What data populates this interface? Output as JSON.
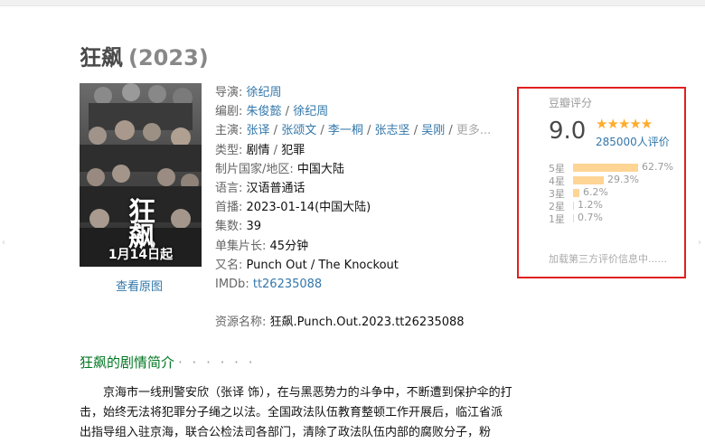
{
  "title": "狂飙",
  "year": "(2023)",
  "poster": {
    "title": "狂飙",
    "date": "1月14日起",
    "view_link": "查看原图"
  },
  "info": {
    "director_label": "导演:",
    "director": "徐纪周",
    "writer_label": "编剧:",
    "writers": [
      "朱俊懿",
      "徐纪周"
    ],
    "cast_label": "主演:",
    "cast": [
      "张译",
      "张颂文",
      "李一桐",
      "张志坚",
      "吴刚"
    ],
    "cast_more": "更多...",
    "genre_label": "类型:",
    "genres": [
      "剧情",
      "犯罪"
    ],
    "country_label": "制片国家/地区:",
    "country": "中国大陆",
    "language_label": "语言:",
    "language": "汉语普通话",
    "premiere_label": "首播:",
    "premiere": "2023-01-14(中国大陆)",
    "episodes_label": "集数:",
    "episodes": "39",
    "runtime_label": "单集片长:",
    "runtime": "45分钟",
    "aka_label": "又名:",
    "aka": "Punch Out / The Knockout",
    "imdb_label": "IMDb:",
    "imdb": "tt26235088"
  },
  "source": {
    "label": "资源名称:",
    "value": "狂飙.Punch.Out.2023.tt26235088"
  },
  "synopsis": {
    "heading": "狂飙的剧情简介",
    "dots": "· · · · · ·",
    "text": "京海市一线刑警安欣（张译 饰），在与黑恶势力的斗争中，不断遭到保护伞的打击，始终无法将犯罪分子绳之以法。全国政法队伍教育整顿工作开展后，临江省派出指导组入驻京海，联合公检法司各部门，清除了政法队伍内部的腐败分子，粉"
  },
  "rating": {
    "title": "豆瓣评分",
    "score": "9.0",
    "stars": "★★★★★",
    "count": "285000人评价",
    "distribution": [
      {
        "label": "5星",
        "pct": "62.7%",
        "value": 62.7
      },
      {
        "label": "4星",
        "pct": "29.3%",
        "value": 29.3
      },
      {
        "label": "3星",
        "pct": "6.2%",
        "value": 6.2
      },
      {
        "label": "2星",
        "pct": "1.2%",
        "value": 1.2
      },
      {
        "label": "1星",
        "pct": "0.7%",
        "value": 0.7
      }
    ],
    "loading": "加载第三方评价信息中......"
  },
  "colors": {
    "link": "#3377aa",
    "green_heading": "#007722",
    "star": "#ffac2d",
    "bar": "#ffd596",
    "highlight_border": "#e02020"
  }
}
